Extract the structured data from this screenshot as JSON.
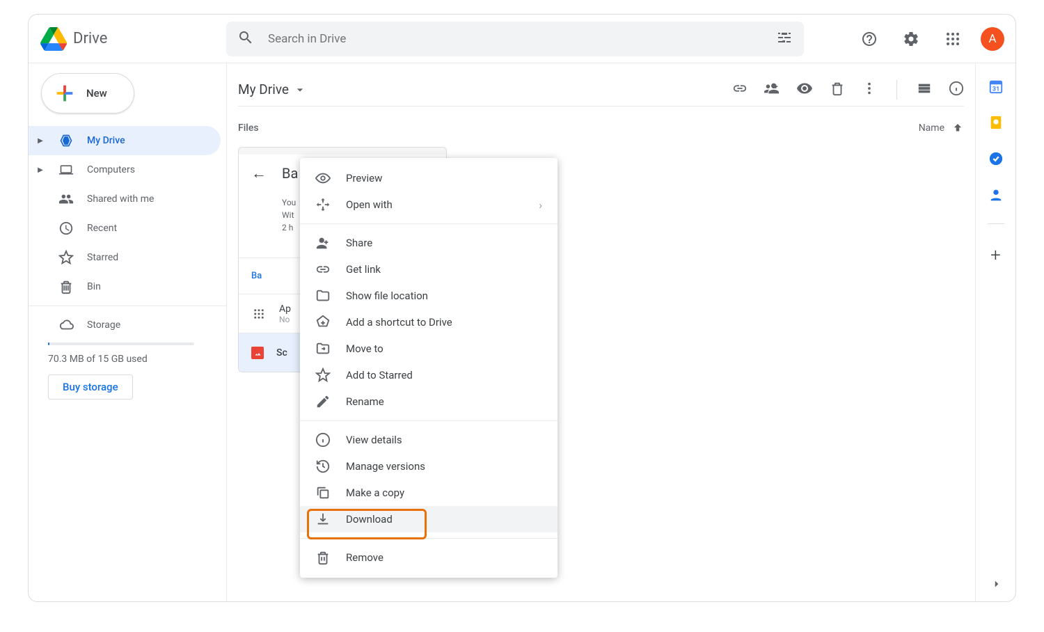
{
  "app": {
    "title": "Drive",
    "avatar_letter": "A"
  },
  "search": {
    "placeholder": "Search in Drive"
  },
  "new_button": {
    "label": "New"
  },
  "sidebar": {
    "items": [
      {
        "label": "My Drive"
      },
      {
        "label": "Computers"
      },
      {
        "label": "Shared with me"
      },
      {
        "label": "Recent"
      },
      {
        "label": "Starred"
      },
      {
        "label": "Bin"
      }
    ],
    "storage_label": "Storage",
    "storage_used": "70.3 MB of 15 GB used",
    "buy_label": "Buy storage"
  },
  "content": {
    "breadcrumb": "My Drive",
    "files_label": "Files",
    "sort_label": "Name",
    "card": {
      "title": "Ba",
      "info1": "You",
      "info2": "Wit",
      "info3": "2 h",
      "section": "Ba",
      "row1_t1": "Ap",
      "row1_t2": "No",
      "row2_t1": "Sc"
    }
  },
  "context_menu": {
    "group1": [
      {
        "label": "Preview",
        "icon": "eye"
      },
      {
        "label": "Open with",
        "icon": "open-with",
        "chevron": true
      }
    ],
    "group2": [
      {
        "label": "Share",
        "icon": "person-add"
      },
      {
        "label": "Get link",
        "icon": "link"
      },
      {
        "label": "Show file location",
        "icon": "folder"
      },
      {
        "label": "Add a shortcut to Drive",
        "icon": "shortcut"
      },
      {
        "label": "Move to",
        "icon": "folder-move"
      },
      {
        "label": "Add to Starred",
        "icon": "star"
      },
      {
        "label": "Rename",
        "icon": "pencil"
      }
    ],
    "group3": [
      {
        "label": "View details",
        "icon": "info"
      },
      {
        "label": "Manage versions",
        "icon": "history"
      },
      {
        "label": "Make a copy",
        "icon": "copy"
      },
      {
        "label": "Download",
        "icon": "download",
        "highlighted": true
      }
    ],
    "group4": [
      {
        "label": "Remove",
        "icon": "trash"
      }
    ]
  }
}
